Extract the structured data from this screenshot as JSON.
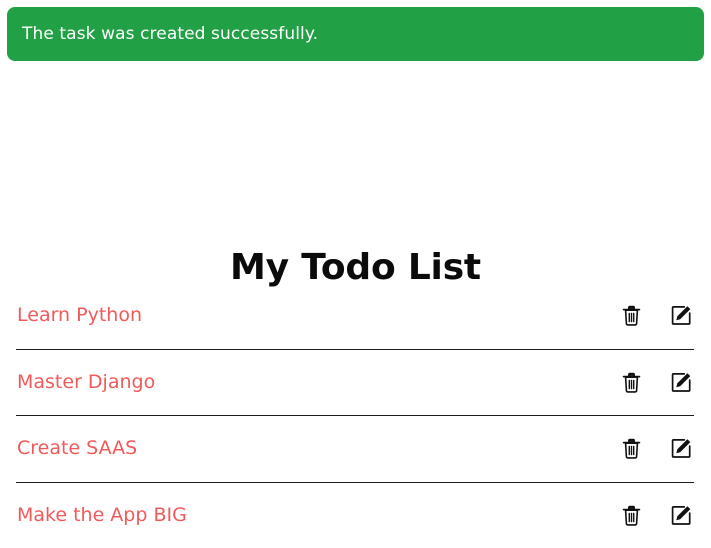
{
  "alert": {
    "message": "The task was created successfully.",
    "type": "success",
    "background_color": "#22a045",
    "text_color": "#ffffff"
  },
  "page": {
    "title": "My Todo List",
    "title_color": "#0b0b0b",
    "background_color": "#ffffff"
  },
  "todo_list": {
    "item_text_color": "#f05a5a",
    "separator_color": "#1c1c1c",
    "items": [
      {
        "title": "Learn Python",
        "delete_icon": "trash-icon",
        "edit_icon": "edit-square-pencil-icon"
      },
      {
        "title": "Master Django",
        "delete_icon": "trash-icon",
        "edit_icon": "edit-square-pencil-icon"
      },
      {
        "title": "Create SAAS",
        "delete_icon": "trash-icon",
        "edit_icon": "edit-square-pencil-icon"
      },
      {
        "title": "Make the App BIG",
        "delete_icon": "trash-icon",
        "edit_icon": "edit-square-pencil-icon"
      }
    ]
  }
}
